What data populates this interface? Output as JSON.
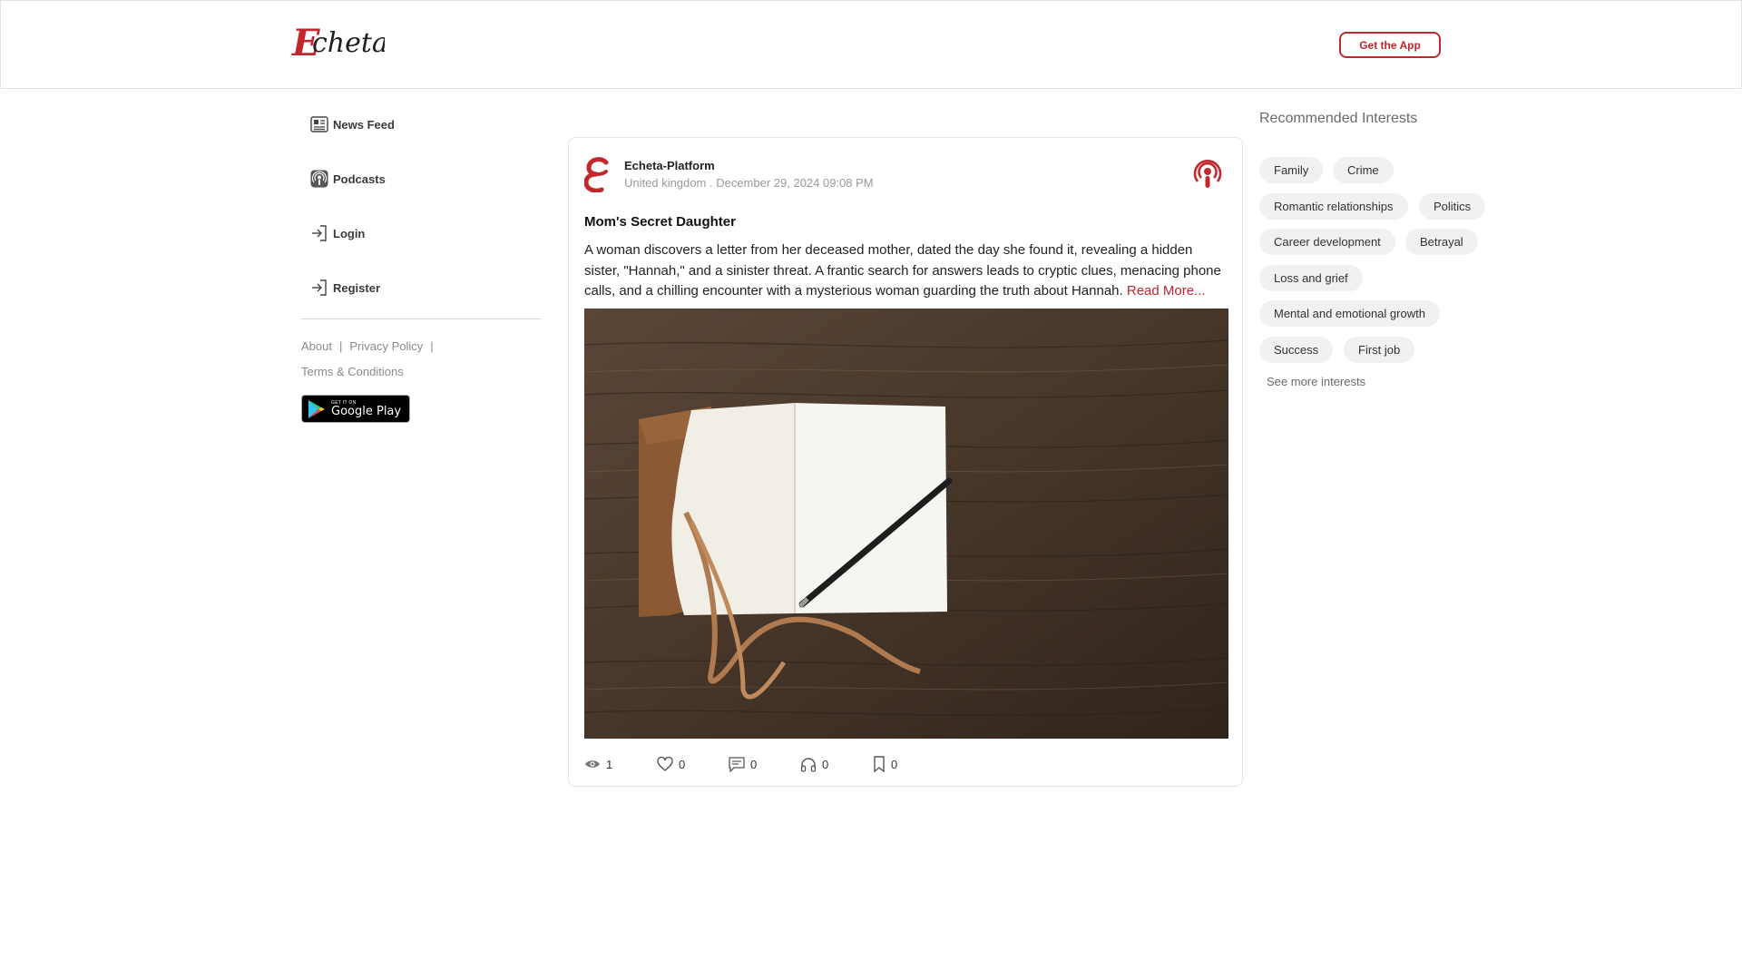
{
  "header": {
    "logo_text": "Echeta",
    "get_app_label": "Get the App",
    "brand_color": "#c1272d"
  },
  "sidebar": {
    "items": [
      {
        "label": "News Feed",
        "icon": "newspaper-icon"
      },
      {
        "label": "Podcasts",
        "icon": "podcast-icon"
      },
      {
        "label": "Login",
        "icon": "login-icon"
      },
      {
        "label": "Register",
        "icon": "register-icon"
      }
    ],
    "footer_links": {
      "about": "About",
      "privacy": "Privacy Policy",
      "terms": "Terms & Conditions",
      "separator": "|"
    },
    "google_play": {
      "small": "GET IT ON",
      "big": "Google Play"
    }
  },
  "post": {
    "author": "Echeta-Platform",
    "location": "United kingdom",
    "date": "December 29, 2024 09:08 PM",
    "meta_separator": ".",
    "title": "Mom's Secret Daughter",
    "body": "A woman discovers a letter from her deceased mother, dated the day she found it, revealing a hidden sister, \"Hannah,\" and a sinister threat. A frantic search for answers leads to cryptic clues, menacing phone calls, and a chilling encounter with a mysterious woman guarding the truth about Hannah. ",
    "read_more": "Read More...",
    "image_icon": "notebook-pen-photo",
    "stats": {
      "views": "1",
      "likes": "0",
      "comments": "0",
      "listens": "0",
      "bookmarks": "0"
    }
  },
  "interests": {
    "title": "Recommended Interests",
    "chips": [
      "Family",
      "Crime",
      "Romantic relationships",
      "Politics",
      "Career development",
      "Betrayal",
      "Loss and grief",
      "Mental and emotional growth",
      "Success",
      "First job"
    ],
    "see_more": "See more interests"
  }
}
